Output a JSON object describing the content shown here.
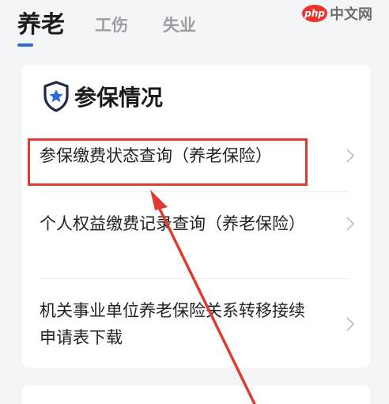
{
  "tabs": [
    {
      "label": "养老",
      "active": true
    },
    {
      "label": "工伤",
      "active": false
    },
    {
      "label": "失业",
      "active": false
    }
  ],
  "watermark": {
    "logo": "php",
    "text": "中文网"
  },
  "section": {
    "title": "参保情况",
    "items": [
      {
        "label": "参保缴费状态查询（养老保险）"
      },
      {
        "label": "个人权益缴费记录查询（养老保险）"
      },
      {
        "label": "机关事业单位养老保险关系转移接续申请表下载"
      }
    ]
  },
  "colors": {
    "accent": "#2f6bd8",
    "highlight": "#e03b32",
    "icon": "#1f2a44"
  },
  "icons": {
    "section": "shield-star-icon",
    "row": "chevron-right-icon"
  }
}
